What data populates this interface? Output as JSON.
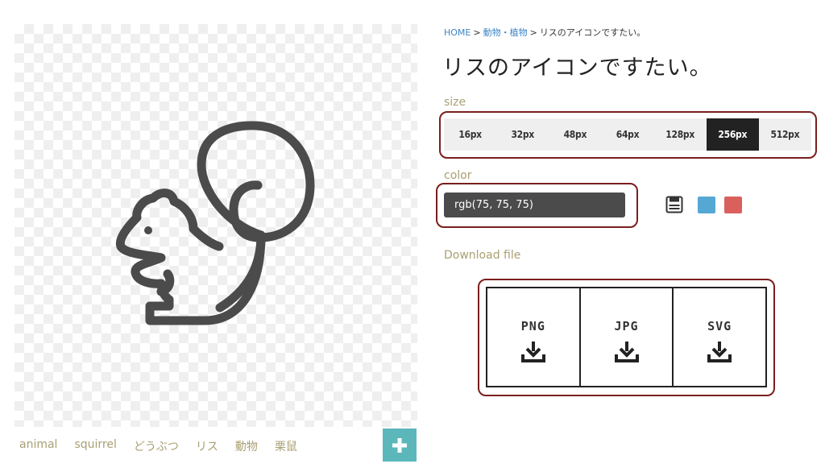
{
  "breadcrumb": {
    "home": "HOME",
    "separator": ">",
    "category": "動物・植物",
    "current": "リスのアイコンですたい。"
  },
  "title": "リスのアイコンですたい。",
  "size": {
    "label": "size",
    "options": [
      "16px",
      "32px",
      "48px",
      "64px",
      "128px",
      "256px",
      "512px"
    ],
    "selected": "256px"
  },
  "color": {
    "label": "color",
    "value": "rgb(75, 75, 75)",
    "save_icon": "save-icon",
    "swatches": [
      "#56a8d4",
      "#d9605d"
    ]
  },
  "download": {
    "label": "Download file",
    "formats": [
      "PNG",
      "JPG",
      "SVG"
    ],
    "icon": "download-icon"
  },
  "tags": [
    "animal",
    "squirrel",
    "どうぶつ",
    "リス",
    "動物",
    "栗鼠"
  ],
  "add_button_icon": "plus-icon",
  "colors": {
    "accent_label": "#a9a074",
    "outline": "#7b1e1e",
    "icon": "#4b4b4b",
    "add_button": "#5cb7bb",
    "link": "#3d85c6"
  }
}
